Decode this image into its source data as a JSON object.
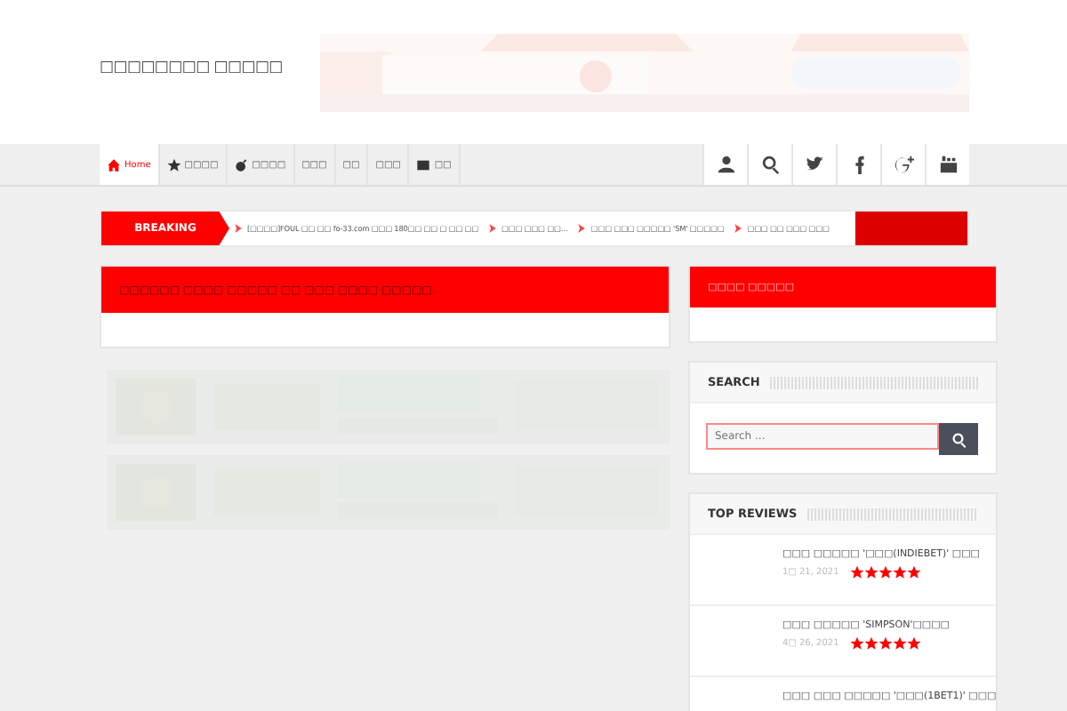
{
  "site_title": "□□□□□□□□ □□□□□",
  "nav": {
    "items": [
      {
        "label": "Home",
        "selected": true
      },
      {
        "label": "□□□□",
        "selected": false
      },
      {
        "label": "□□□□",
        "selected": false
      },
      {
        "label": "□□□",
        "selected": false
      },
      {
        "label": "□□",
        "selected": false
      },
      {
        "label": "□□□",
        "selected": false
      },
      {
        "label": "□□",
        "selected": false
      }
    ]
  },
  "breaking": {
    "label": "BREAKING",
    "items": [
      "[□□□□]FOUL □□ □□ fo-33.com □□□ 180□□ □□ □ □□ □□",
      "□□□ □□□ □□…",
      "□□□ □□□ □□□□□ 'SM' □□□□□",
      "□□□ □□ □□□ □□□"
    ]
  },
  "main_box": {
    "title": "□□□□□□ □□□□ □□□□□ □□ □□□ □□□□ □□□□□."
  },
  "side_box": {
    "title": "□□□□ □□□□□"
  },
  "search": {
    "title": "SEARCH",
    "placeholder": "Search ..."
  },
  "reviews": {
    "title": "TOP REVIEWS",
    "items": [
      {
        "title": "□□□ □□□□□ '□□□(INDIEBET)' □□□",
        "date": "1□ 21, 2021",
        "stars": 5
      },
      {
        "title": "□□□ □□□□□ 'SIMPSON'□□□□",
        "date": "4□ 26, 2021",
        "stars": 5
      },
      {
        "title": "□□□ □□□ □□□□□ '□□□(1BET1)' □□□"
      }
    ]
  }
}
